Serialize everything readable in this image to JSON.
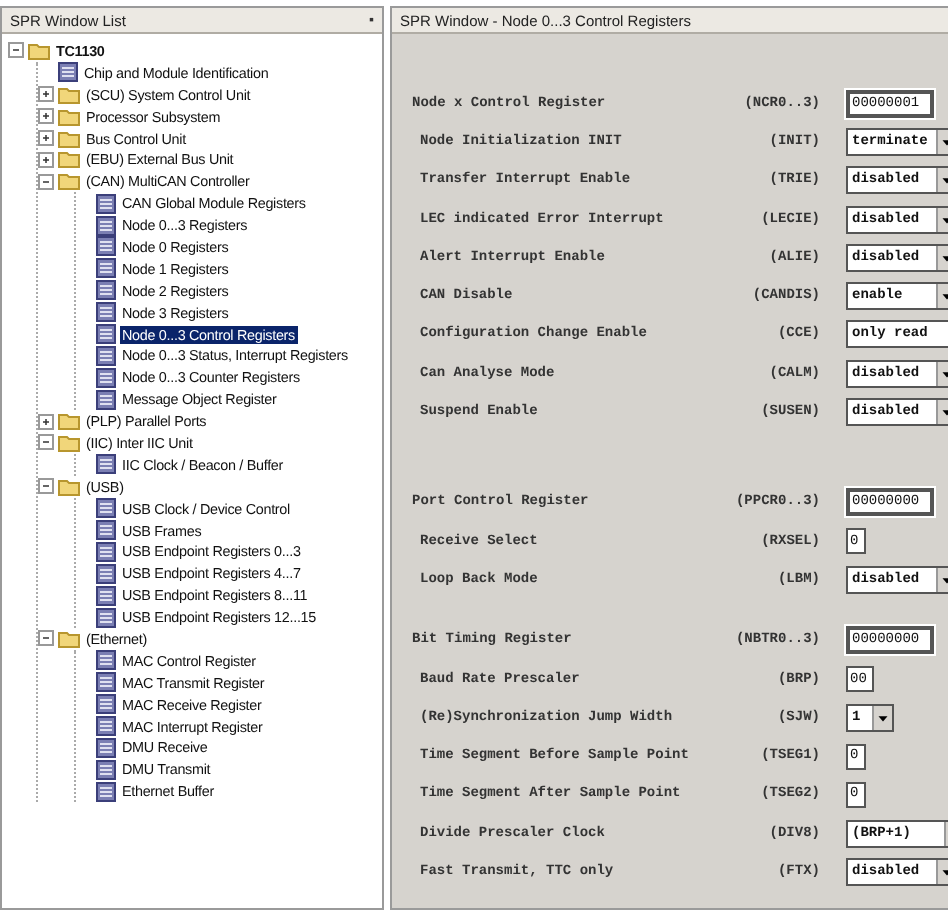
{
  "tree_panel": {
    "title": "SPR Window List",
    "pin": "▪",
    "items": [
      {
        "label": "TC1130",
        "kind": "folder",
        "expanded": true,
        "selected": false,
        "children": [
          {
            "label": "Chip and Module Identification",
            "kind": "register",
            "selected": false
          },
          {
            "label": "(SCU) System Control Unit",
            "kind": "folder",
            "expanded": false,
            "selected": false
          },
          {
            "label": "Processor Subsystem",
            "kind": "folder",
            "expanded": false,
            "selected": false
          },
          {
            "label": "Bus Control Unit",
            "kind": "folder",
            "expanded": false,
            "selected": false
          },
          {
            "label": "(EBU) External Bus Unit",
            "kind": "folder",
            "expanded": false,
            "selected": false
          },
          {
            "label": "(CAN) MultiCAN Controller",
            "kind": "folder",
            "expanded": true,
            "selected": false,
            "children": [
              {
                "label": "CAN Global Module Registers",
                "kind": "register",
                "selected": false
              },
              {
                "label": "Node 0...3 Registers",
                "kind": "register",
                "selected": false
              },
              {
                "label": "Node 0 Registers",
                "kind": "register",
                "selected": false
              },
              {
                "label": "Node 1 Registers",
                "kind": "register",
                "selected": false
              },
              {
                "label": "Node 2 Registers",
                "kind": "register",
                "selected": false
              },
              {
                "label": "Node 3 Registers",
                "kind": "register",
                "selected": false
              },
              {
                "label": "Node 0...3 Control Registers",
                "kind": "register",
                "selected": true
              },
              {
                "label": "Node 0...3 Status, Interrupt Registers",
                "kind": "register",
                "selected": false
              },
              {
                "label": "Node 0...3 Counter Registers",
                "kind": "register",
                "selected": false
              },
              {
                "label": "Message Object Register",
                "kind": "register",
                "selected": false
              }
            ]
          },
          {
            "label": "(PLP) Parallel Ports",
            "kind": "folder",
            "expanded": false,
            "selected": false
          },
          {
            "label": "(IIC) Inter IIC Unit",
            "kind": "folder",
            "expanded": true,
            "selected": false,
            "children": [
              {
                "label": "IIC Clock / Beacon / Buffer",
                "kind": "register",
                "selected": false
              }
            ]
          },
          {
            "label": "(USB)",
            "kind": "folder",
            "expanded": true,
            "selected": false,
            "children": [
              {
                "label": "USB Clock / Device Control",
                "kind": "register",
                "selected": false
              },
              {
                "label": "USB Frames",
                "kind": "register",
                "selected": false
              },
              {
                "label": "USB Endpoint Registers 0...3",
                "kind": "register",
                "selected": false
              },
              {
                "label": "USB Endpoint Registers 4...7",
                "kind": "register",
                "selected": false
              },
              {
                "label": "USB Endpoint Registers 8...11",
                "kind": "register",
                "selected": false
              },
              {
                "label": "USB Endpoint Registers 12...15",
                "kind": "register",
                "selected": false
              }
            ]
          },
          {
            "label": "(Ethernet)",
            "kind": "folder",
            "expanded": true,
            "selected": false,
            "children": [
              {
                "label": "MAC Control Register",
                "kind": "register",
                "selected": false
              },
              {
                "label": "MAC Transmit Register",
                "kind": "register",
                "selected": false
              },
              {
                "label": "MAC Receive Register",
                "kind": "register",
                "selected": false
              },
              {
                "label": "MAC Interrupt Register",
                "kind": "register",
                "selected": false
              },
              {
                "label": "DMU Receive",
                "kind": "register",
                "selected": false
              },
              {
                "label": "DMU Transmit",
                "kind": "register",
                "selected": false
              },
              {
                "label": "Ethernet Buffer",
                "kind": "register",
                "selected": false
              }
            ]
          }
        ]
      }
    ]
  },
  "register_panel": {
    "title": "SPR Window - Node 0...3 Control Registers",
    "groups": [
      {
        "rows": [
          {
            "name": "Node x Control Register",
            "abbr": "(NCR0..3)",
            "kind": "hex",
            "value": "00000001"
          },
          {
            "name": "Node Initialization INIT",
            "abbr": "(INIT)",
            "kind": "select",
            "value": "terminate"
          },
          {
            "name": "Transfer Interrupt Enable",
            "abbr": "(TRIE)",
            "kind": "select",
            "value": "disabled"
          },
          {
            "name": "LEC indicated Error Interrupt",
            "abbr": "(LECIE)",
            "kind": "select",
            "value": "disabled"
          },
          {
            "name": "Alert Interrupt Enable",
            "abbr": "(ALIE)",
            "kind": "select",
            "value": "disabled"
          },
          {
            "name": "CAN Disable",
            "abbr": "(CANDIS)",
            "kind": "select",
            "value": "enable"
          },
          {
            "name": "Configuration Change Enable",
            "abbr": "(CCE)",
            "kind": "readonly",
            "value": "only read"
          },
          {
            "name": "Can Analyse Mode",
            "abbr": "(CALM)",
            "kind": "select",
            "value": "disabled"
          },
          {
            "name": "Suspend Enable",
            "abbr": "(SUSEN)",
            "kind": "select",
            "value": "disabled"
          }
        ]
      },
      {
        "rows": [
          {
            "name": "Port Control Register",
            "abbr": "(PPCR0..3)",
            "kind": "hex",
            "value": "00000000"
          },
          {
            "name": "Receive Select",
            "abbr": "(RXSEL)",
            "kind": "text",
            "value": "0"
          },
          {
            "name": "Loop Back Mode",
            "abbr": "(LBM)",
            "kind": "select",
            "value": "disabled"
          }
        ]
      },
      {
        "rows": [
          {
            "name": "Bit Timing Register",
            "abbr": "(NBTR0..3)",
            "kind": "hex",
            "value": "00000000"
          },
          {
            "name": "Baud Rate Prescaler",
            "abbr": "(BRP)",
            "kind": "text",
            "value": "00"
          },
          {
            "name": "(Re)Synchronization Jump Width",
            "abbr": "(SJW)",
            "kind": "small-select",
            "value": "1"
          },
          {
            "name": "Time Segment Before Sample Point",
            "abbr": "(TSEG1)",
            "kind": "text",
            "value": "0"
          },
          {
            "name": "Time Segment After Sample Point",
            "abbr": "(TSEG2)",
            "kind": "text",
            "value": "0"
          },
          {
            "name": "Divide Prescaler Clock",
            "abbr": "(DIV8)",
            "kind": "wide-select",
            "value": "(BRP+1)"
          },
          {
            "name": "Fast Transmit, TTC only",
            "abbr": "(FTX)",
            "kind": "select",
            "value": "disabled"
          }
        ]
      }
    ]
  }
}
